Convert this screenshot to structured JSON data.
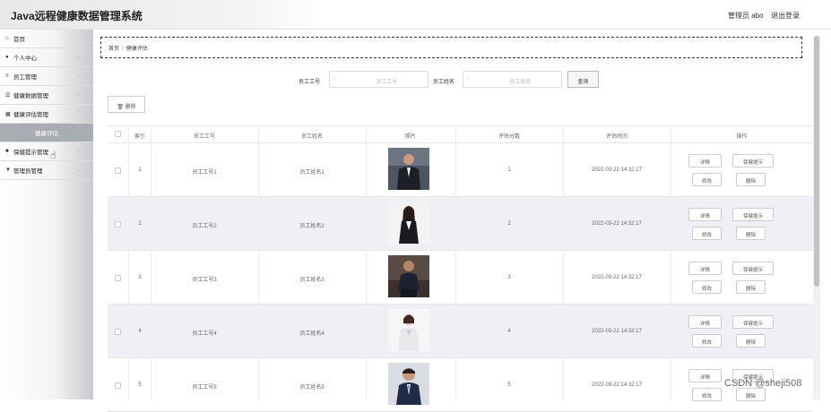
{
  "app": {
    "title": "Java远程健康数据管理系统"
  },
  "header": {
    "admin_label": "管理员 abo",
    "logout": "退出登录"
  },
  "sidebar": {
    "items": [
      {
        "label": "首页",
        "icon": "home-icon"
      },
      {
        "label": "个人中心",
        "icon": "user-icon"
      },
      {
        "label": "员工管理",
        "icon": "list-icon"
      },
      {
        "label": "健康数据管理",
        "icon": "stack-icon"
      },
      {
        "label": "健康评估管理",
        "icon": "grid-icon"
      },
      {
        "label": "健康评估",
        "active": true
      },
      {
        "label": "保健提示管理",
        "icon": "file-icon"
      },
      {
        "label": "管理员管理",
        "icon": "person-icon"
      }
    ]
  },
  "breadcrumb": {
    "home": "首页",
    "separator": "/",
    "current": "健康评估"
  },
  "search": {
    "employee_no_label": "员工工号",
    "employee_no_placeholder": "员工工号",
    "employee_name_label": "员工姓名",
    "employee_name_placeholder": "员工姓名",
    "button": "查询"
  },
  "toolbar": {
    "delete": "删除"
  },
  "table": {
    "headers": [
      "索引",
      "员工工号",
      "员工姓名",
      "照片",
      "评估分数",
      "评估时间",
      "操作"
    ],
    "actions": {
      "detail": "详情",
      "tip": "保健提示",
      "edit": "修改",
      "delete": "删除"
    },
    "rows": [
      {
        "index": "1",
        "employee_no": "员工工号1",
        "employee_name": "员工姓名1",
        "score": "1",
        "time": "2022-03-22 14:32:17"
      },
      {
        "index": "2",
        "employee_no": "员工工号2",
        "employee_name": "员工姓名2",
        "score": "2",
        "time": "2022-03-22 14:32:17"
      },
      {
        "index": "3",
        "employee_no": "员工工号3",
        "employee_name": "员工姓名3",
        "score": "3",
        "time": "2022-03-22 14:32:17"
      },
      {
        "index": "4",
        "employee_no": "员工工号4",
        "employee_name": "员工姓名4",
        "score": "4",
        "time": "2022-03-22 14:32:17"
      },
      {
        "index": "5",
        "employee_no": "员工工号5",
        "employee_name": "员工姓名5",
        "score": "5",
        "time": "2022-03-22 14:32:17"
      }
    ]
  },
  "watermark": "CSDN @sheji508"
}
